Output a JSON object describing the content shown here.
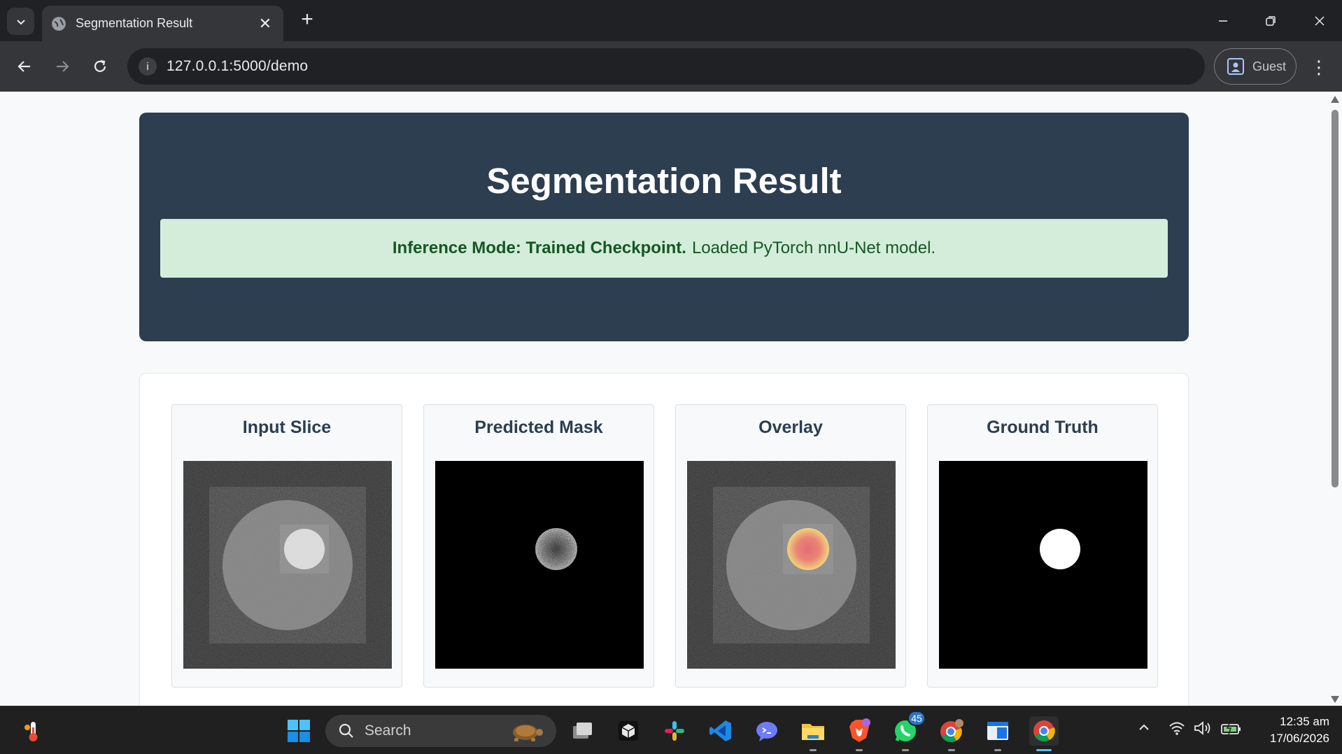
{
  "browser": {
    "tab_title": "Segmentation Result",
    "new_tab_symbol": "+",
    "url": "127.0.0.1:5000/demo",
    "profile_label": "Guest",
    "icons": [
      "tab-search-icon",
      "globe-icon",
      "close-icon",
      "back-icon",
      "forward-icon",
      "reload-icon",
      "site-info-icon",
      "profile-icon",
      "kebab-menu-icon",
      "minimize-icon",
      "restore-icon",
      "window-close-icon"
    ]
  },
  "page": {
    "title": "Segmentation Result",
    "alert": {
      "bold": "Inference Mode: Trained Checkpoint.",
      "text": "Loaded PyTorch nnU-Net model."
    },
    "panels": [
      {
        "title": "Input Slice"
      },
      {
        "title": "Predicted Mask"
      },
      {
        "title": "Overlay"
      },
      {
        "title": "Ground Truth"
      }
    ]
  },
  "taskbar": {
    "search_label": "Search",
    "whatsapp_badge": "45",
    "time": "12:35 am",
    "date": "17/06/2026",
    "icons": [
      "thermometer-icon",
      "windows-start-icon",
      "search-icon",
      "task-view-icon",
      "cube-app-icon",
      "slack-icon",
      "vscode-icon",
      "chat-app-icon",
      "file-explorer-icon",
      "brave-icon",
      "whatsapp-icon",
      "chrome-profile-icon",
      "window-app-icon",
      "chrome-icon",
      "tray-chevron-icon",
      "wifi-icon",
      "volume-icon",
      "battery-icon"
    ]
  },
  "colors": {
    "header_bg": "#2c3e50",
    "alert_bg": "#d4edda",
    "alert_text": "#155724"
  }
}
